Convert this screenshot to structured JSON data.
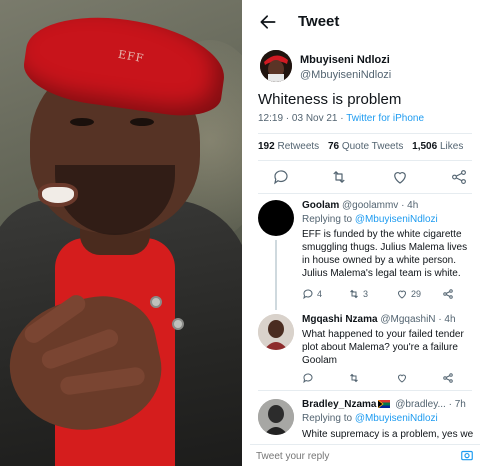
{
  "photo": {
    "beret_text": "EFF"
  },
  "header": {
    "title": "Tweet"
  },
  "tweet": {
    "author_name": "Mbuyiseni Ndlozi",
    "author_handle": "@MbuyiseniNdlozi",
    "text": "Whiteness is problem",
    "time": "12:19 · 03 Nov 21 · ",
    "source": "Twitter for iPhone",
    "retweets_count": "192",
    "retweets_label": "Retweets",
    "quotes_count": "76",
    "quotes_label": "Quote Tweets",
    "likes_count": "1,506",
    "likes_label": "Likes"
  },
  "replies": [
    {
      "name": "Goolam",
      "handle": "@goolammv",
      "age": "· 4h",
      "replying_prefix": "Replying to ",
      "replying_to": "@MbuyiseniNdlozi",
      "text": "EFF is funded by the white cigarette smuggling thugs. Julius Malema lives in house owned by a white person.  Julius Malema's legal team is white.",
      "replies": "4",
      "retweets": "3",
      "likes": "29"
    },
    {
      "name": "Mgqashi Nzama",
      "handle": "@MgqashiN",
      "age": "· 4h",
      "text": "What happened to your failed tender plot about Malema? you're a failure Goolam"
    },
    {
      "name": "Bradley_Nzama",
      "handle": "@bradley...",
      "age": "· 7h",
      "replying_prefix": "Replying to ",
      "replying_to": "@MbuyiseniNdlozi",
      "text": "White supremacy is a problem, yes we"
    }
  ],
  "compose": {
    "placeholder": "Tweet your reply"
  },
  "colors": {
    "accent": "#1d9bf0",
    "text": "#0f1419",
    "muted": "#536471",
    "beret": "#c8141b"
  },
  "icons": [
    "back-arrow-icon",
    "reply-icon",
    "retweet-icon",
    "like-icon",
    "share-icon",
    "camera-icon",
    "south-africa-flag-icon"
  ]
}
